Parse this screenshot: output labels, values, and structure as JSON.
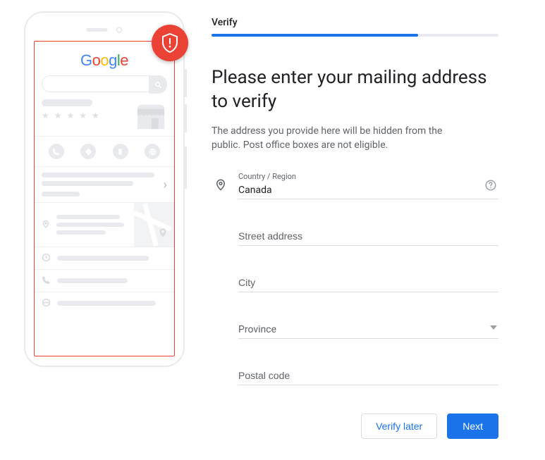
{
  "tab_label": "Verify",
  "progress_pct": 72,
  "headline": "Please enter your mailing address to verify",
  "sub": "The address you provide here will be hidden from the public. Post office boxes are not eligible.",
  "fields": {
    "country": {
      "label": "Country / Region",
      "value": "Canada"
    },
    "street": {
      "placeholder": "Street address",
      "value": ""
    },
    "city": {
      "placeholder": "City",
      "value": ""
    },
    "province": {
      "placeholder": "Province",
      "value": ""
    },
    "postal": {
      "placeholder": "Postal code",
      "value": ""
    }
  },
  "buttons": {
    "later": "Verify later",
    "next": "Next"
  },
  "phone": {
    "logo_text": "Google",
    "stars": "★ ★ ★ ★ ★"
  }
}
